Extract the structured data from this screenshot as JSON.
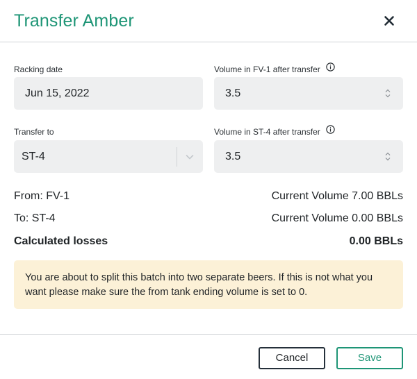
{
  "dialog": {
    "title": "Transfer Amber",
    "close_icon": "close-icon"
  },
  "form": {
    "racking_date": {
      "label": "Racking date",
      "value": "Jun 15, 2022"
    },
    "volume_source": {
      "label": "Volume in FV-1 after transfer",
      "value": "3.5",
      "icon": "info-icon"
    },
    "transfer_to": {
      "label": "Transfer to",
      "value": "ST-4",
      "icon": "chevron-down-icon"
    },
    "volume_dest": {
      "label": "Volume in ST-4 after transfer",
      "value": "3.5",
      "icon": "info-icon"
    }
  },
  "summary": {
    "from_label": "From: FV-1",
    "from_volume": "Current Volume 7.00 BBLs",
    "to_label": "To: ST-4",
    "to_volume": "Current Volume 0.00 BBLs",
    "losses_label": "Calculated losses",
    "losses_value": "0.00 BBLs"
  },
  "warning": {
    "text": "You are about to split this batch into two separate beers. If this is not what you want please make sure the from tank ending volume is set to 0.",
    "background": "#fcf1d7"
  },
  "footer": {
    "cancel_label": "Cancel",
    "save_label": "Save"
  },
  "colors": {
    "accent": "#1e9576",
    "input_background": "#eeeff0"
  }
}
